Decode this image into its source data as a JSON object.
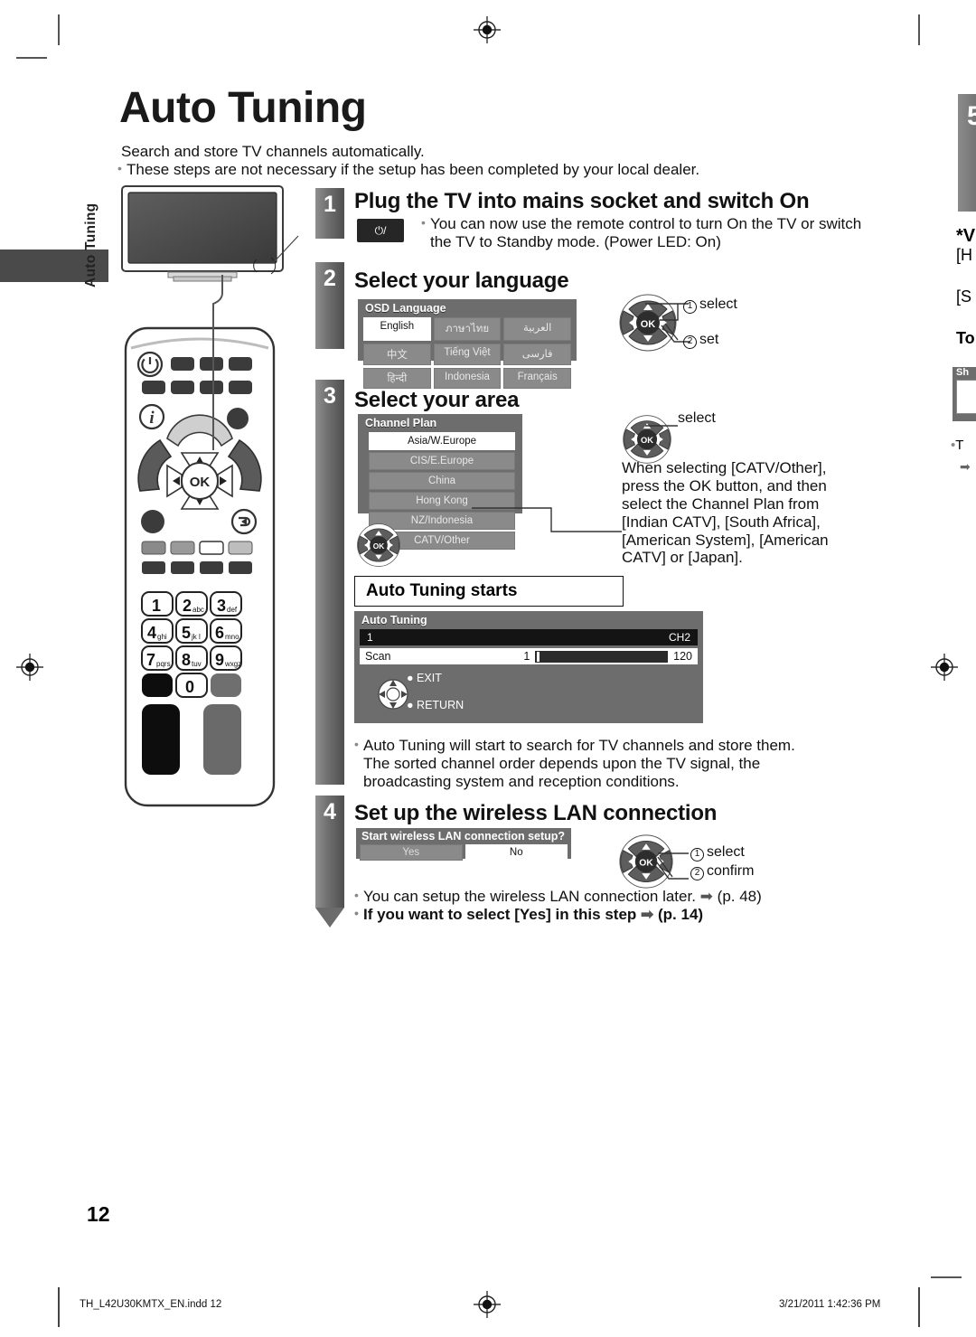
{
  "page": {
    "number": "12",
    "side_tab": "Auto Tuning",
    "title": "Auto Tuning",
    "intro_line1": "Search and store TV channels automatically.",
    "intro_line2": "These steps are not necessary if the setup has been completed by your local dealer."
  },
  "steps": [
    {
      "number": "1",
      "heading": "Plug the TV into mains socket and switch On",
      "power_button_label": "/",
      "body_line1": "You can now use the remote control to turn On the TV or switch",
      "body_line2": "the TV to Standby mode. (Power LED: On)"
    },
    {
      "number": "2",
      "heading": "Select your language",
      "osd": {
        "title": "OSD Language",
        "options": [
          {
            "label": "English",
            "selected": true
          },
          {
            "label": "ภาษาไทย",
            "selected": false
          },
          {
            "label": "العربية",
            "selected": false
          },
          {
            "label": "中文",
            "selected": false
          },
          {
            "label": "Tiếng Việt",
            "selected": false
          },
          {
            "label": "فارسی",
            "selected": false
          },
          {
            "label": "हिन्दी",
            "selected": false
          },
          {
            "label": "Indonesia",
            "selected": false
          },
          {
            "label": "Français",
            "selected": false
          }
        ]
      },
      "callouts": [
        {
          "marker": "1",
          "label": "select"
        },
        {
          "marker": "2",
          "label": "set"
        }
      ]
    },
    {
      "number": "3",
      "heading": "Select your area",
      "osd": {
        "title": "Channel Plan",
        "options": [
          {
            "label": "Asia/W.Europe",
            "selected": true
          },
          {
            "label": "CIS/E.Europe",
            "selected": false
          },
          {
            "label": "China",
            "selected": false
          },
          {
            "label": "Hong Kong",
            "selected": false
          },
          {
            "label": "NZ/Indonesia",
            "selected": false
          },
          {
            "label": "CATV/Other",
            "selected": false
          }
        ]
      },
      "callout_select": "select",
      "note_lines": [
        "When selecting [CATV/Other],",
        "press the OK button, and then",
        "select the Channel Plan from",
        "[Indian CATV], [South Africa],",
        "[American System], [American",
        "CATV] or [Japan]."
      ],
      "starts_box": "Auto Tuning starts",
      "progress": {
        "title": "Auto Tuning",
        "row_left": "1",
        "row_right": "CH2",
        "scan_label": "Scan",
        "scan_from": "1",
        "scan_to": "120",
        "exit_label": "EXIT",
        "return_label": "RETURN"
      },
      "after_lines": [
        "Auto Tuning will start to search for TV channels and store them.",
        "The sorted channel order depends upon the TV signal, the",
        "broadcasting system and reception conditions."
      ]
    },
    {
      "number": "4",
      "heading": "Set up the wireless LAN connection",
      "dialog": {
        "title": "Start wireless LAN connection setup?",
        "options": [
          {
            "label": "Yes",
            "selected": false
          },
          {
            "label": "No",
            "selected": true
          }
        ]
      },
      "callouts": [
        {
          "marker": "1",
          "label": "select"
        },
        {
          "marker": "2",
          "label": "confirm"
        }
      ],
      "footnote_normal": "You can setup the wireless LAN connection later.",
      "footnote_normal_ref": "(p. 48)",
      "footnote_bold": "If you want to select [Yes] in this step",
      "footnote_bold_ref": "(p. 14)"
    }
  ],
  "bleed": {
    "step_number": "5",
    "l1": "*V",
    "l2": "[H",
    "l3": "[S",
    "l4": "To",
    "l5": "Sh",
    "l6": "T"
  },
  "remote": {
    "power_icon": "power-icon",
    "info_icon": "info-icon",
    "ok_label": "OK",
    "return_icon": "return-icon",
    "keypad": [
      {
        "digit": "1",
        "letters": ""
      },
      {
        "digit": "2",
        "letters": "abc"
      },
      {
        "digit": "3",
        "letters": "def"
      },
      {
        "digit": "4",
        "letters": "ghi"
      },
      {
        "digit": "5",
        "letters": "jk l"
      },
      {
        "digit": "6",
        "letters": "mno"
      },
      {
        "digit": "7",
        "letters": "pqrs"
      },
      {
        "digit": "8",
        "letters": "tuv"
      },
      {
        "digit": "9",
        "letters": "wxgz"
      },
      {
        "digit": "0",
        "letters": ""
      }
    ]
  },
  "footer": {
    "file": "TH_L42U30KMTX_EN.indd   12",
    "timestamp": "3/21/2011   1:42:36 PM"
  },
  "colors": {
    "osd_panel": "#6d6d6d",
    "osd_cell": "#8a8a8a",
    "selected": "#ffffff",
    "step_bar": "#6e6e6e",
    "ink": "#111111"
  }
}
